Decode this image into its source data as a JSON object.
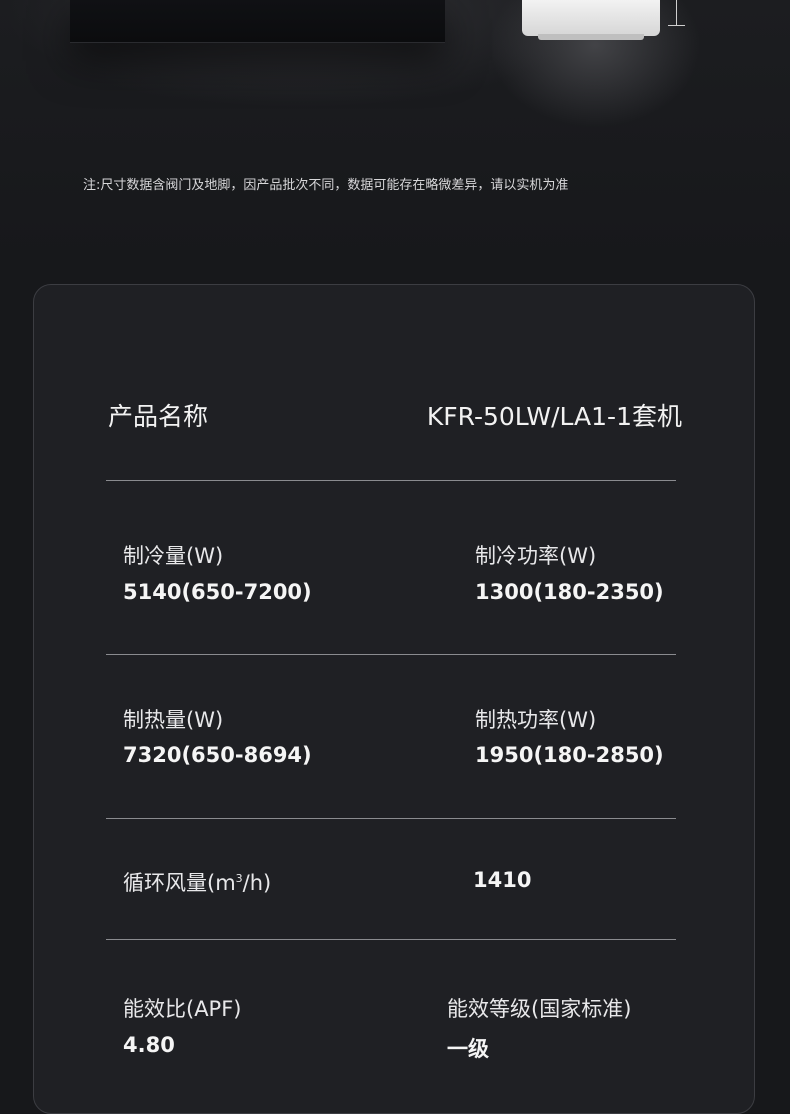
{
  "note": "注:尺寸数据含阀门及地脚，因产品批次不同，数据可能存在略微差异，请以实机为准",
  "specs": {
    "title_label": "产品名称",
    "title_value": "KFR-50LW/LA1-1套机",
    "cooling_capacity": {
      "label": "制冷量(W)",
      "value": "5140(650-7200)"
    },
    "cooling_power": {
      "label": "制冷功率(W)",
      "value": "1300(180-2350)"
    },
    "heating_capacity": {
      "label": "制热量(W)",
      "value": "7320(650-8694)"
    },
    "heating_power": {
      "label": "制热功率(W)",
      "value": "1950(180-2850)"
    },
    "airflow": {
      "label_prefix": "循环风量(m",
      "label_sup": "3",
      "label_suffix": "/h)",
      "value": "1410"
    },
    "apf": {
      "label": "能效比(APF)",
      "value": "4.80"
    },
    "efficiency_grade": {
      "label": "能效等级(国家标准)",
      "value": "一级"
    }
  }
}
